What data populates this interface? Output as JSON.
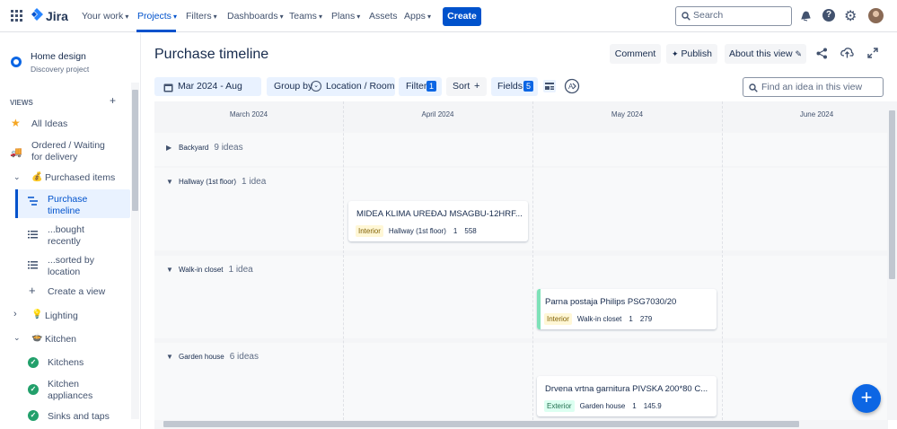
{
  "topnav": {
    "logo_text": "Jira",
    "items": [
      {
        "label": "Your work"
      },
      {
        "label": "Projects"
      },
      {
        "label": "Filters"
      },
      {
        "label": "Dashboards"
      },
      {
        "label": "Teams"
      },
      {
        "label": "Plans"
      },
      {
        "label": "Assets"
      },
      {
        "label": "Apps"
      }
    ],
    "create_label": "Create",
    "search_placeholder": "Search"
  },
  "sidebar": {
    "project_name": "Home design",
    "project_type": "Discovery project",
    "views_label": "VIEWS",
    "add_label": "+",
    "items": [
      {
        "label": "All Ideas"
      },
      {
        "label": "Ordered / Waiting for delivery"
      },
      {
        "label": "Purchased items"
      },
      {
        "label": "Purchase timeline"
      },
      {
        "label": "...bought recently"
      },
      {
        "label": "...sorted by location"
      },
      {
        "label": "Create a view"
      },
      {
        "label": "Lighting"
      },
      {
        "label": "Kitchen"
      },
      {
        "label": "Kitchens"
      },
      {
        "label": "Kitchen appliances"
      },
      {
        "label": "Sinks and taps"
      }
    ]
  },
  "main": {
    "title": "Purchase timeline",
    "actions": {
      "comment": "Comment",
      "publish": "Publish",
      "about": "About this view"
    },
    "toolbar": {
      "date_range": "Mar 2024 - Aug 2024",
      "group_by_label": "Group by",
      "group_by_value": "Location / Room",
      "filter_label": "Filter",
      "filter_count": "1",
      "sort_label": "Sort",
      "fields_label": "Fields",
      "fields_count": "5",
      "find_placeholder": "Find an idea in this view"
    }
  },
  "timeline": {
    "months": [
      "March 2024",
      "April 2024",
      "May 2024",
      "June 2024"
    ],
    "groups": [
      {
        "name": "Backyard",
        "count": "9 ideas"
      },
      {
        "name": "Hallway (1st floor)",
        "count": "1 idea"
      },
      {
        "name": "Walk-in closet",
        "count": "1 idea"
      },
      {
        "name": "Garden house",
        "count": "6 ideas"
      }
    ],
    "cards": [
      {
        "title": "MIDEA KLIMA UREĐAJ MSAGBU-12HRF...",
        "tag": "Interior",
        "location": "Hallway (1st floor)",
        "qty": "1",
        "price": "558"
      },
      {
        "title": "Parna postaja Philips PSG7030/20",
        "tag": "Interior",
        "location": "Walk-in closet",
        "qty": "1",
        "price": "279"
      },
      {
        "title": "Drvena vrtna garnitura PIVSKA 200*80 C...",
        "tag": "Exterior",
        "location": "Garden house",
        "qty": "1",
        "price": "145.9"
      }
    ]
  },
  "colors": {
    "brand": "#0052cc",
    "selected_bg": "#e9f2ff",
    "interior_tag": "#fff7d6",
    "exterior_tag": "#dcfff1",
    "success": "#22a06b"
  }
}
